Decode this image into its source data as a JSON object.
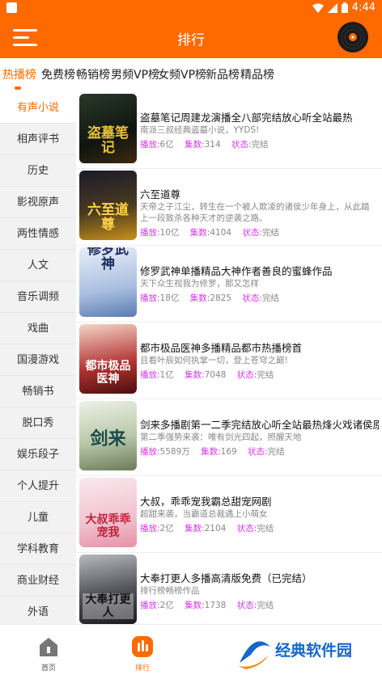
{
  "status_bar": {
    "time": "4:44"
  },
  "app_bar": {
    "title": "排行"
  },
  "tabs": [
    {
      "label": "热播榜",
      "active": true
    },
    {
      "label": "免费榜"
    },
    {
      "label": "畅销榜"
    },
    {
      "label": "男频VP榜"
    },
    {
      "label": "女频VP榜"
    },
    {
      "label": "新品榜"
    },
    {
      "label": "精品榜"
    }
  ],
  "categories": [
    {
      "label": "有声小说",
      "active": true
    },
    {
      "label": "相声评书"
    },
    {
      "label": "历史"
    },
    {
      "label": "影视原声"
    },
    {
      "label": "两性情感"
    },
    {
      "label": "人文"
    },
    {
      "label": "音乐调频"
    },
    {
      "label": "戏曲"
    },
    {
      "label": "国漫游戏"
    },
    {
      "label": "畅销书"
    },
    {
      "label": "脱口秀"
    },
    {
      "label": "娱乐段子"
    },
    {
      "label": "个人提升"
    },
    {
      "label": "儿童"
    },
    {
      "label": "学科教育"
    },
    {
      "label": "商业财经"
    },
    {
      "label": "外语"
    }
  ],
  "meta_labels": {
    "plays": "播放:",
    "episodes": "集数:",
    "status": "状态:"
  },
  "items": [
    {
      "cover_text": "盗墓笔记",
      "title": "盗墓笔记周建龙演播全八部完结放心听全站最热",
      "desc": "南派三叔经典盗墓小说，YYDS!",
      "plays": "6亿",
      "episodes": "314",
      "status": "完结"
    },
    {
      "cover_text": "六至道尊",
      "title": "六至道尊",
      "desc": "天帝之子江尘，转生在一个被人欺凌的诸侯少年身上，从此踏上一段致杀各种天才的逆袭之路。",
      "plays": "10亿",
      "episodes": "4104",
      "status": "完结"
    },
    {
      "cover_text": "修罗武神",
      "title": "修罗武神单播精品大神作者善良的蜜蜂作品",
      "desc": "天下众生视我为修罗，那又怎样",
      "plays": "18亿",
      "episodes": "2825",
      "status": "完结"
    },
    {
      "cover_text": "都市极品医神",
      "title": "都市极品医神多播精品都市热播榜首",
      "desc": "且看叶辰如何执掌一切，登上苍穹之巅!",
      "plays": "1亿",
      "episodes": "7048",
      "status": "完结"
    },
    {
      "cover_text": "剑来",
      "title": "剑来多播剧第一二季完结放心听全站最热烽火戏诸侯原著",
      "desc": "第二季强势来袭：唯有剑光四起，照醒天地",
      "plays": "5589万",
      "episodes": "169",
      "status": "完结"
    },
    {
      "cover_text": "大叔乖乖宠我",
      "title": "大叔，乖乖宠我霸总甜宠网剧",
      "desc": "超甜来袭，当霸道总裁遇上小萌女",
      "plays": "2亿",
      "episodes": "2104",
      "status": "完结"
    },
    {
      "cover_text": "大奉打更人",
      "title": "大奉打更人多播高清版免费（已完结）",
      "desc": "排行榜畅榜作品",
      "plays": "2亿",
      "episodes": "1738",
      "status": "完结"
    }
  ],
  "bottom_nav": [
    {
      "label": "首页"
    },
    {
      "label": "排行",
      "active": true
    }
  ],
  "watermark": {
    "text": "经典软件园"
  },
  "colors": {
    "accent": "#ff6a00",
    "meta_key": "#d63ae8"
  }
}
